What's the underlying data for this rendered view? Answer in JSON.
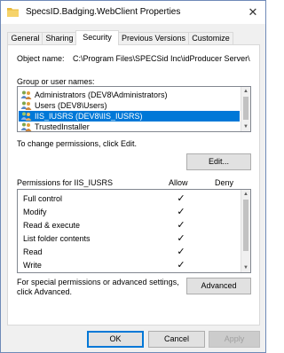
{
  "window": {
    "title": "SpecsID.Badging.WebClient Properties",
    "close_glyph": "✕"
  },
  "tabs": [
    {
      "label": "General",
      "active": false
    },
    {
      "label": "Sharing",
      "active": false
    },
    {
      "label": "Security",
      "active": true
    },
    {
      "label": "Previous Versions",
      "active": false
    },
    {
      "label": "Customize",
      "active": false
    }
  ],
  "security": {
    "object_name_label": "Object name:",
    "object_name_value": "C:\\Program Files\\SPECSid Inc\\idProducer Server\\",
    "group_label": "Group or user names:",
    "users": [
      {
        "label": "Administrators (DEV8\\Administrators)",
        "icon": "user-group-icon",
        "selected": false
      },
      {
        "label": "Users (DEV8\\Users)",
        "icon": "user-group-icon",
        "selected": false
      },
      {
        "label": "IIS_IUSRS (DEV8\\IIS_IUSRS)",
        "icon": "user-group-icon",
        "selected": true
      },
      {
        "label": "TrustedInstaller",
        "icon": "user-group-icon",
        "selected": false
      }
    ],
    "change_permissions_text": "To change permissions, click Edit.",
    "edit_button": "Edit...",
    "permissions_for_label": "Permissions for IIS_IUSRS",
    "allow_header": "Allow",
    "deny_header": "Deny",
    "permissions": [
      {
        "name": "Full control",
        "allow": true,
        "deny": false
      },
      {
        "name": "Modify",
        "allow": true,
        "deny": false
      },
      {
        "name": "Read & execute",
        "allow": true,
        "deny": false
      },
      {
        "name": "List folder contents",
        "allow": true,
        "deny": false
      },
      {
        "name": "Read",
        "allow": true,
        "deny": false
      },
      {
        "name": "Write",
        "allow": true,
        "deny": false
      }
    ],
    "check_glyph": "✓",
    "special_text_line1": "For special permissions or advanced settings,",
    "special_text_line2": "click Advanced.",
    "advanced_button": "Advanced"
  },
  "footer": {
    "ok": "OK",
    "cancel": "Cancel",
    "apply": "Apply"
  },
  "colors": {
    "selection": "#0078d7",
    "window_bg": "#f0f0f0",
    "panel_bg": "#ffffff"
  }
}
